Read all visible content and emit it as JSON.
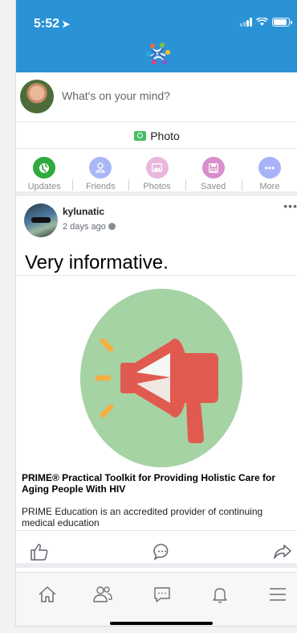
{
  "status_bar": {
    "time": "5:52",
    "location_glyph": "➤"
  },
  "composer": {
    "prompt": "What's on your mind?",
    "photo_label": "Photo"
  },
  "quick_nav": [
    {
      "label": "Updates",
      "color": "#2eaa3e",
      "icon": "globe-icon"
    },
    {
      "label": "Friends",
      "color": "#a9b8f5",
      "icon": "person-icon"
    },
    {
      "label": "Photos",
      "color": "#e8b7dc",
      "icon": "image-icon"
    },
    {
      "label": "Saved",
      "color": "#d98fcb",
      "icon": "save-icon"
    },
    {
      "label": "More",
      "color": "#a8b3f7",
      "icon": "more-dots-icon",
      "glyph": "•••"
    }
  ],
  "post": {
    "author": "kylunatic",
    "time": "2 days ago",
    "more": "•••",
    "text": "Very informative.",
    "link": {
      "title": "PRIME® Practical Toolkit for Providing Holistic Care for Aging People With HIV",
      "description": "PRIME Education is an accredited provider of continuing medical education"
    }
  },
  "colors": {
    "header_blue": "#2a93d6",
    "megaphone_bg": "#a5d3a4",
    "megaphone_red": "#e15a4f",
    "megaphone_accent": "#f2b043"
  },
  "tab_bar": [
    "home-icon",
    "friends-icon",
    "messages-icon",
    "notifications-icon",
    "menu-icon"
  ]
}
